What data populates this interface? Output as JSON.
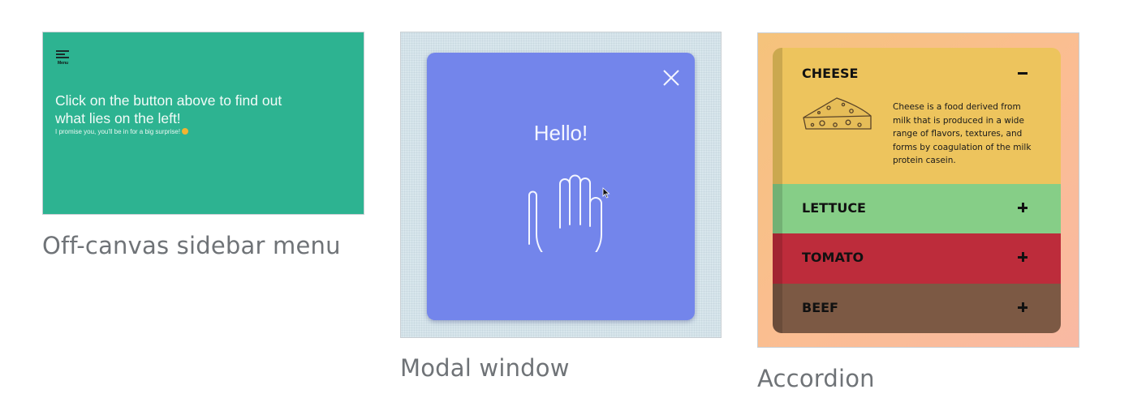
{
  "cards": {
    "offcanvas": {
      "caption": "Off-canvas sidebar menu",
      "menu_label": "Menu",
      "title": "Click on the button above to find out what lies on the left!",
      "subtitle": "I promise you, you'll be in for a big surprise!",
      "background": "#2db391"
    },
    "modal": {
      "caption": "Modal window",
      "greeting": "Hello!",
      "modal_color": "#7385eb",
      "icons": [
        "close-icon",
        "hand-wave-icon",
        "mouse-cursor-icon"
      ]
    },
    "accordion": {
      "caption": "Accordion",
      "items": [
        {
          "title": "CHEESE",
          "state": "expanded",
          "color": "#edc45d",
          "icon": "minus-icon",
          "body": "Cheese is a food derived from milk that is produced in a wide range of flavors, textures, and forms by coagulation of the milk protein casein."
        },
        {
          "title": "LETTUCE",
          "state": "collapsed",
          "color": "#86ce87",
          "icon": "plus-icon"
        },
        {
          "title": "TOMATO",
          "state": "collapsed",
          "color": "#bd2c3b",
          "icon": "plus-icon"
        },
        {
          "title": "BEEF",
          "state": "collapsed",
          "color": "#7c5944",
          "icon": "plus-icon"
        }
      ]
    }
  }
}
